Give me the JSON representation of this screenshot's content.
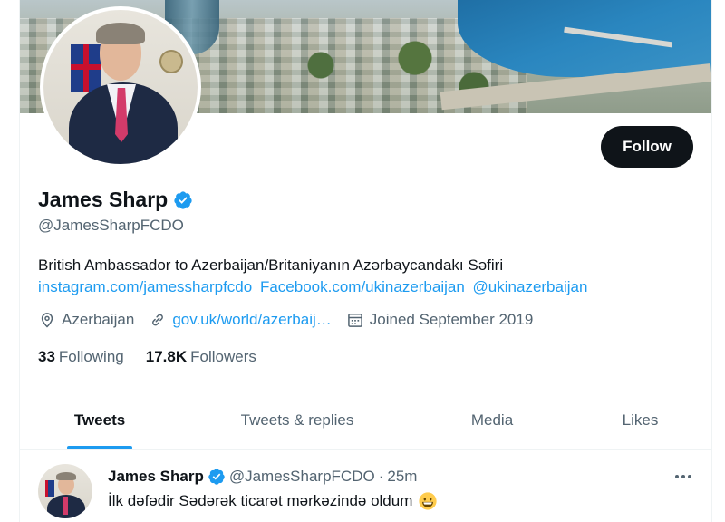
{
  "profile": {
    "name": "James Sharp",
    "handle": "@JamesSharpFCDO",
    "bio": "British Ambassador to Azerbaijan/Britaniyanın Azərbaycandakı Səfiri",
    "bio_links": [
      "instagram.com/jamessharpfcdo",
      "Facebook.com/ukinazerbaijan",
      "@ukinazerbaijan"
    ],
    "location": "Azerbaijan",
    "website": "gov.uk/world/azerbaij…",
    "joined": "Joined September 2019",
    "following_count": "33",
    "following_label": "Following",
    "followers_count": "17.8K",
    "followers_label": "Followers",
    "verified": true
  },
  "follow_button": {
    "label": "Follow"
  },
  "tabs": [
    {
      "label": "Tweets",
      "active": true
    },
    {
      "label": "Tweets & replies",
      "active": false
    },
    {
      "label": "Media",
      "active": false
    },
    {
      "label": "Likes",
      "active": false
    }
  ],
  "tweet": {
    "name": "James Sharp",
    "handle": "@JamesSharpFCDO",
    "dot": "·",
    "time": "25m",
    "text": "İlk dəfədir Sədərək ticarət mərkəzində oldum"
  },
  "icons": {
    "location": "location-pin-icon",
    "link": "link-icon",
    "calendar": "calendar-icon",
    "verified": "verified-badge-icon",
    "more": "more-options-icon",
    "emoji": "grinning-face-emoji"
  },
  "colors": {
    "accent": "#1d9bf0",
    "text_primary": "#0f1419",
    "text_secondary": "#536471",
    "follow_button_bg": "#0f1419"
  }
}
